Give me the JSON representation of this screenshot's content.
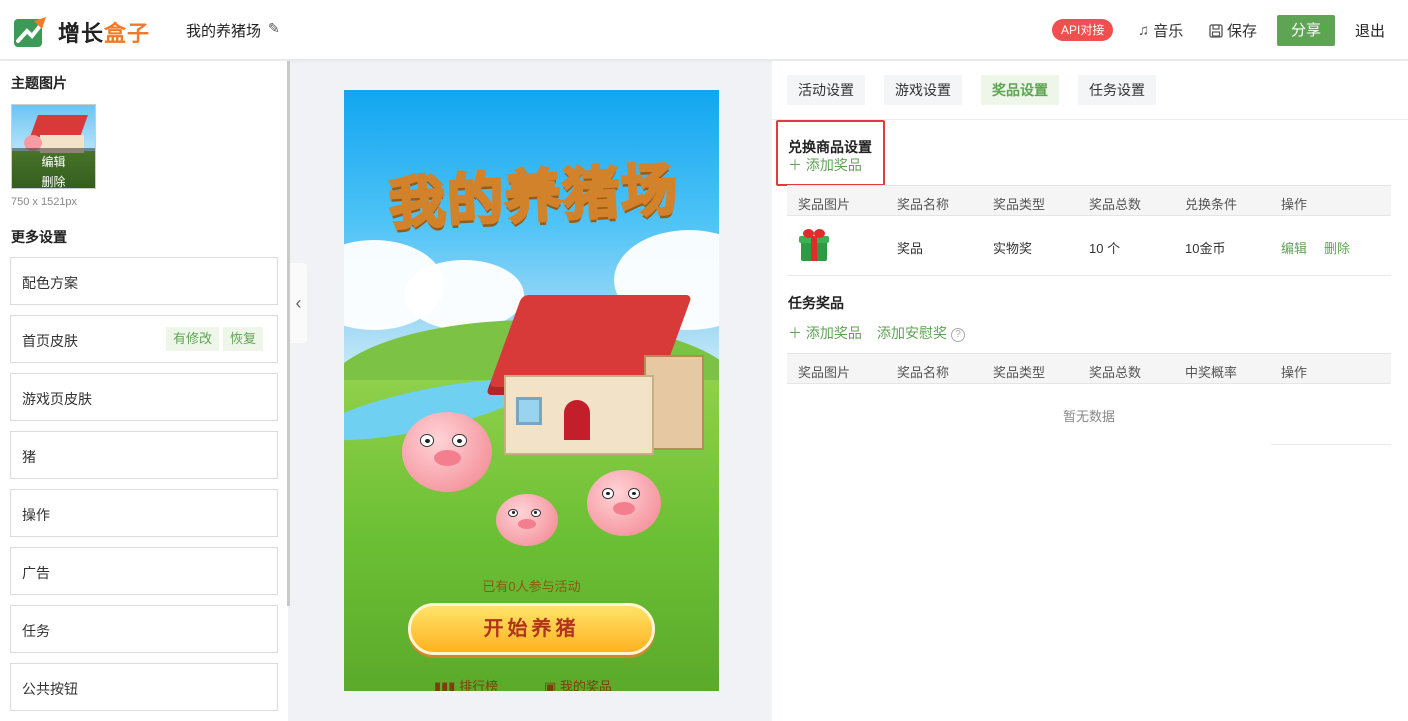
{
  "header": {
    "logo_part1": "增长",
    "logo_part2": "盒子",
    "project_title": "我的养猪场",
    "api_badge": "API对接",
    "music_label": "音乐",
    "save_label": "保存",
    "share_label": "分享",
    "logout_label": "退出"
  },
  "left": {
    "theme_image_title": "主题图片",
    "thumb_edit": "编辑",
    "thumb_delete": "删除",
    "thumb_dimensions": "750 x 1521px",
    "more_settings_title": "更多设置",
    "items": [
      {
        "label": "配色方案"
      },
      {
        "label": "首页皮肤",
        "tag1": "有修改",
        "tag2": "恢复"
      },
      {
        "label": "游戏页皮肤"
      },
      {
        "label": "猪"
      },
      {
        "label": "操作"
      },
      {
        "label": "广告"
      },
      {
        "label": "任务"
      },
      {
        "label": "公共按钮"
      }
    ]
  },
  "preview": {
    "title": "我的养猪场",
    "participants": "已有0人参与活动",
    "start_button": "开始养猪",
    "rank_link": "排行榜",
    "prizes_link": "我的奖品"
  },
  "right": {
    "tabs": [
      "活动设置",
      "游戏设置",
      "奖品设置",
      "任务设置"
    ],
    "active_tab": "奖品设置",
    "exchange": {
      "title": "兑换商品设置",
      "add_label": "添加奖品",
      "columns": [
        "奖品图片",
        "奖品名称",
        "奖品类型",
        "奖品总数",
        "兑换条件",
        "操作"
      ],
      "rows": [
        {
          "name": "奖品",
          "type": "实物奖",
          "total": "10 个",
          "condition": "10金币",
          "edit": "编辑",
          "delete": "删除",
          "icon": "gift-icon"
        }
      ]
    },
    "task": {
      "title": "任务奖品",
      "add_label": "添加奖品",
      "add_consolation_label": "添加安慰奖",
      "help_glyph": "?",
      "columns": [
        "奖品图片",
        "奖品名称",
        "奖品类型",
        "奖品总数",
        "中奖概率",
        "操作"
      ],
      "empty_text": "暂无数据"
    }
  },
  "colors": {
    "accent_green": "#5fa454",
    "api_red": "#f04f4f",
    "logo_orange": "#f07a2a",
    "highlight_red": "#e23b3b"
  }
}
